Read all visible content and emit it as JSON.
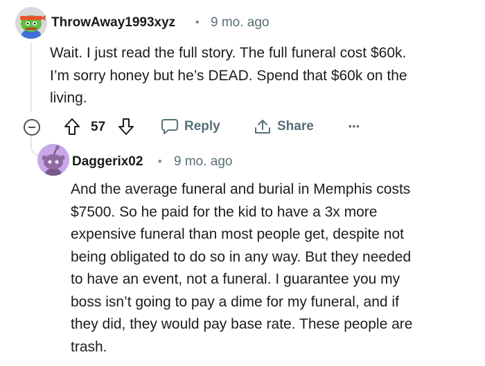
{
  "comment1": {
    "username": "ThrowAway1993xyz",
    "separator": "•",
    "time": "9 mo. ago",
    "body_lines": [
      "Wait. I just read the full story. The full funeral cost $60k.",
      "I’m sorry honey but he’s DEAD. Spend that $60k on the",
      "living."
    ],
    "avatar_icon": "snoo-avatar-headband-icon",
    "actions": {
      "vote_count": "57",
      "reply_label": "Reply",
      "share_label": "Share",
      "more_label": "•••"
    }
  },
  "comment2": {
    "username": "Daggerix02",
    "separator": "•",
    "time": "9 mo. ago",
    "avatar_icon": "snoo-avatar-purple-icon",
    "body_lines": [
      "And the average funeral and burial in Memphis costs",
      "$7500. So he paid for the kid to have a 3x more",
      "expensive funeral than most people get, despite not",
      "being obligated to do so in any way. But they needed",
      "to have an event, not a funeral. I guarantee you my",
      "boss isn’t going to pay a dime for my funeral, and if",
      "they did, they would pay base rate. These people are",
      "trash."
    ]
  },
  "colors": {
    "text": "#1c1c1c",
    "meta": "#576f76",
    "thread_line": "#e5e5e5",
    "avatar1_bg": "#d9d9d9",
    "avatar2_bg": "#c9a6e8"
  }
}
